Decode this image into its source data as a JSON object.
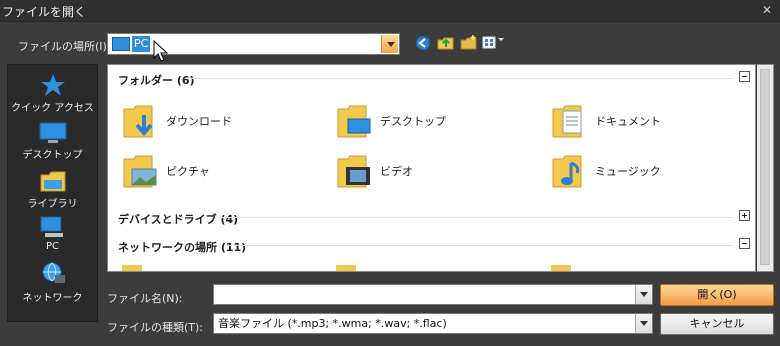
{
  "window": {
    "title": "ファイルを開く",
    "close": "✕"
  },
  "location": {
    "label": "ファイルの場所(I):",
    "value": "PC"
  },
  "toolbar": {
    "icons": [
      "back-icon",
      "up-folder-icon",
      "new-folder-icon",
      "view-menu-icon"
    ]
  },
  "sidebar": {
    "items": [
      {
        "label": "クイック アクセス",
        "icon": "star-icon"
      },
      {
        "label": "デスクトップ",
        "icon": "desktop-icon"
      },
      {
        "label": "ライブラリ",
        "icon": "library-icon"
      },
      {
        "label": "PC",
        "icon": "pc-icon"
      },
      {
        "label": "ネットワーク",
        "icon": "network-icon"
      }
    ]
  },
  "groups": {
    "folders": {
      "title": "フォルダー (6)",
      "state": "expanded"
    },
    "devices": {
      "title": "デバイスとドライブ (4)",
      "state": "collapsed"
    },
    "network": {
      "title": "ネットワークの場所 (11)",
      "state": "expanded"
    }
  },
  "folders": [
    {
      "name": "ダウンロード",
      "icon": "downloads-folder-icon"
    },
    {
      "name": "デスクトップ",
      "icon": "desktop-folder-icon"
    },
    {
      "name": "ドキュメント",
      "icon": "documents-folder-icon"
    },
    {
      "name": "ピクチャ",
      "icon": "pictures-folder-icon"
    },
    {
      "name": "ビデオ",
      "icon": "videos-folder-icon"
    },
    {
      "name": "ミュージック",
      "icon": "music-folder-icon"
    }
  ],
  "filename": {
    "label": "ファイル名(N):",
    "value": ""
  },
  "filetype": {
    "label": "ファイルの種類(T):",
    "value": "音楽ファイル (*.mp3; *.wma; *.wav; *.flac)"
  },
  "buttons": {
    "open": "開く(O)",
    "cancel": "キャンセル"
  },
  "colors": {
    "dialog_bg": "#3c3c3c",
    "accent_orange": "#f39d45",
    "selection_blue": "#2f8fd8"
  }
}
